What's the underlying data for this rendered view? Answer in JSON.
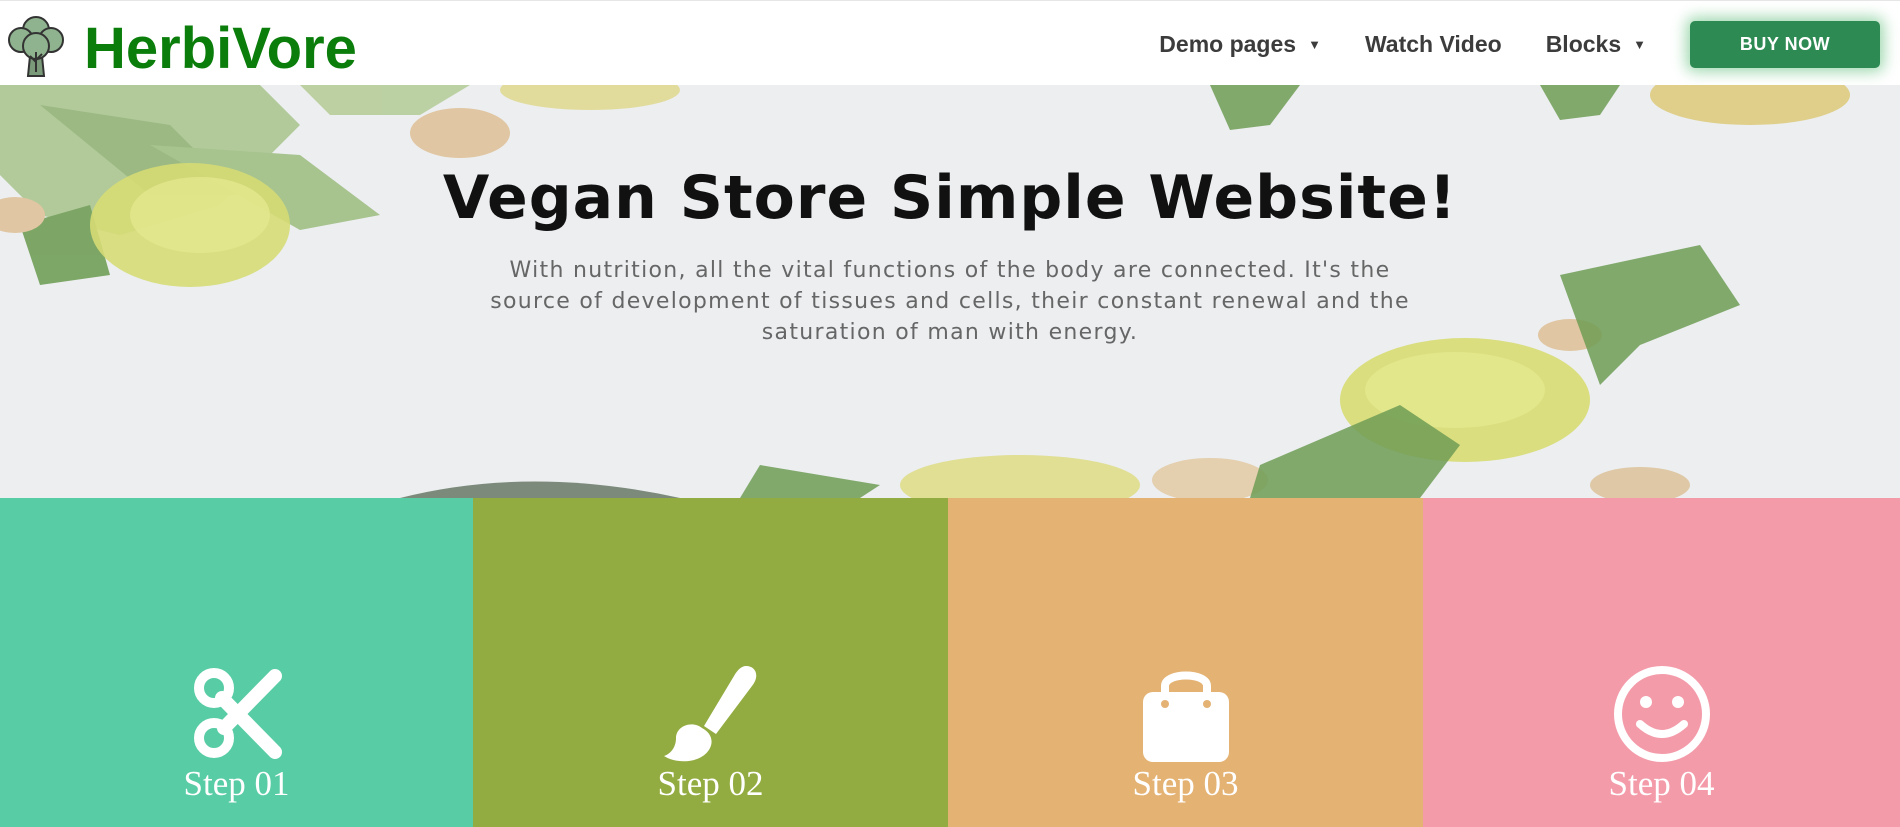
{
  "header": {
    "brand": "HerbiVore",
    "logo_icon": "broccoli-icon",
    "nav": [
      {
        "label": "Demo pages",
        "has_dropdown": true
      },
      {
        "label": "Watch Video",
        "has_dropdown": false
      },
      {
        "label": "Blocks",
        "has_dropdown": true
      }
    ],
    "cta_label": "BUY NOW",
    "brand_color": "#0b7d0b",
    "cta_color": "#2d8a53"
  },
  "hero": {
    "title": "Vegan Store Simple Website!",
    "subtitle": "With nutrition, all the vital functions of the body are connected. It's the source of development of tissues and cells, their constant renewal and the saturation of man with energy."
  },
  "steps": [
    {
      "label": "Step 01",
      "icon": "scissors-icon",
      "color": "#58cca5"
    },
    {
      "label": "Step 02",
      "icon": "paintbrush-icon",
      "color": "#93ac41"
    },
    {
      "label": "Step 03",
      "icon": "shopping-bag-icon",
      "color": "#e4b273"
    },
    {
      "label": "Step 04",
      "icon": "smiley-icon",
      "color": "#f49baa"
    }
  ]
}
